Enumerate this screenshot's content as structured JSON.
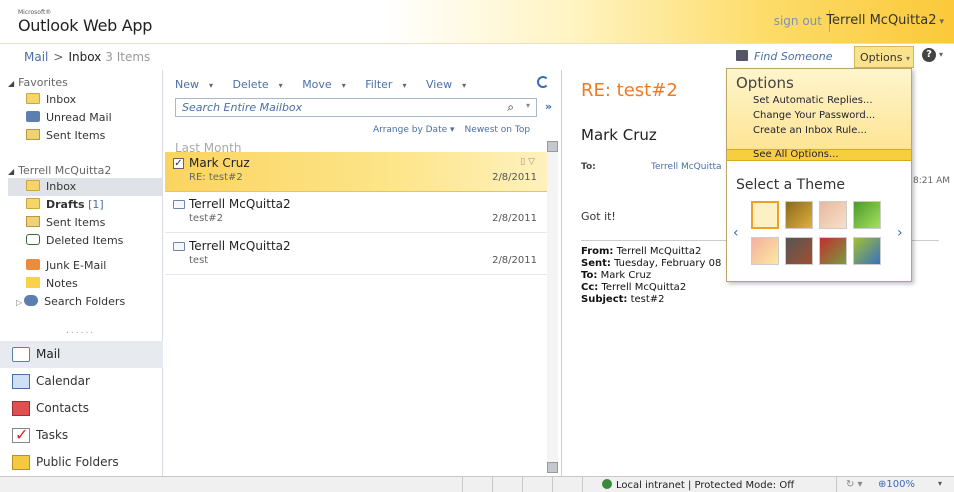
{
  "header": {
    "logo_small": "Microsoft®",
    "logo": "Outlook Web App",
    "sign_out": "sign out",
    "user": "Terrell McQuitta2",
    "user_caret": "▾"
  },
  "breadcrumb": {
    "mail": "Mail",
    "separator": ">",
    "inbox": "Inbox",
    "count": "3 Items"
  },
  "topactions": {
    "find_someone": "Find Someone",
    "options": "Options",
    "options_caret": "▾",
    "help": "?",
    "help_caret": "▾"
  },
  "nav": {
    "favorites": "Favorites",
    "favorites_items": [
      "Inbox",
      "Unread Mail",
      "Sent Items"
    ],
    "account": "Terrell McQuitta2",
    "folders": [
      {
        "label": "Inbox",
        "icon": "inbox-icon"
      },
      {
        "label": "Drafts",
        "count": "[1]",
        "icon": "drafts-icon"
      },
      {
        "label": "Sent Items",
        "icon": "sent-icon"
      },
      {
        "label": "Deleted Items",
        "icon": "deleted-icon"
      },
      {
        "label": "Junk E-Mail",
        "icon": "junk-icon"
      },
      {
        "label": "Notes",
        "icon": "notes-icon"
      },
      {
        "label": "Search Folders",
        "icon": "search-folder-icon"
      }
    ],
    "dots": "......",
    "modules": [
      "Mail",
      "Calendar",
      "Contacts",
      "Tasks",
      "Public Folders"
    ]
  },
  "list": {
    "toolbar": [
      "New",
      "Delete",
      "Move",
      "Filter",
      "View"
    ],
    "search_placeholder": "Search Entire Mailbox",
    "arrange_by": "Arrange by Date",
    "sort_order": "Newest on Top",
    "group": "Last Month",
    "messages": [
      {
        "from": "Mark Cruz",
        "subject": "RE: test#2",
        "date": "2/8/2011",
        "selected": true
      },
      {
        "from": "Terrell McQuitta2",
        "subject": "test#2",
        "date": "2/8/2011",
        "selected": false
      },
      {
        "from": "Terrell McQuitta2",
        "subject": "test",
        "date": "2/8/2011",
        "selected": false
      }
    ]
  },
  "reading": {
    "title": "RE: test#2",
    "from": "Mark Cruz",
    "to_label": "To:",
    "to": "Terrell McQuitta",
    "time": "11 8:21 AM",
    "body": "Got it!",
    "quoted": {
      "from_label": "From:",
      "from": "Terrell McQuitta2",
      "sent_label": "Sent:",
      "sent": "Tuesday, February 08",
      "to_label": "To:",
      "to": "Mark Cruz",
      "cc_label": "Cc:",
      "cc": "Terrell McQuitta2",
      "subject_label": "Subject:",
      "subject": "test#2"
    }
  },
  "options_menu": {
    "title": "Options",
    "items": [
      "Set Automatic Replies...",
      "Change Your Password...",
      "Create an Inbox Rule...",
      "See All Options..."
    ],
    "theme_title": "Select a Theme",
    "themes": [
      "#fdf0c4",
      "#8a6a1a",
      "#e8b8a0",
      "#7cc04a",
      "#f4b0a0",
      "#666666",
      "#c03030",
      "#3a70c0"
    ]
  },
  "status": {
    "zone": "Local intranet | Protected Mode: Off",
    "zoom": "100%"
  }
}
